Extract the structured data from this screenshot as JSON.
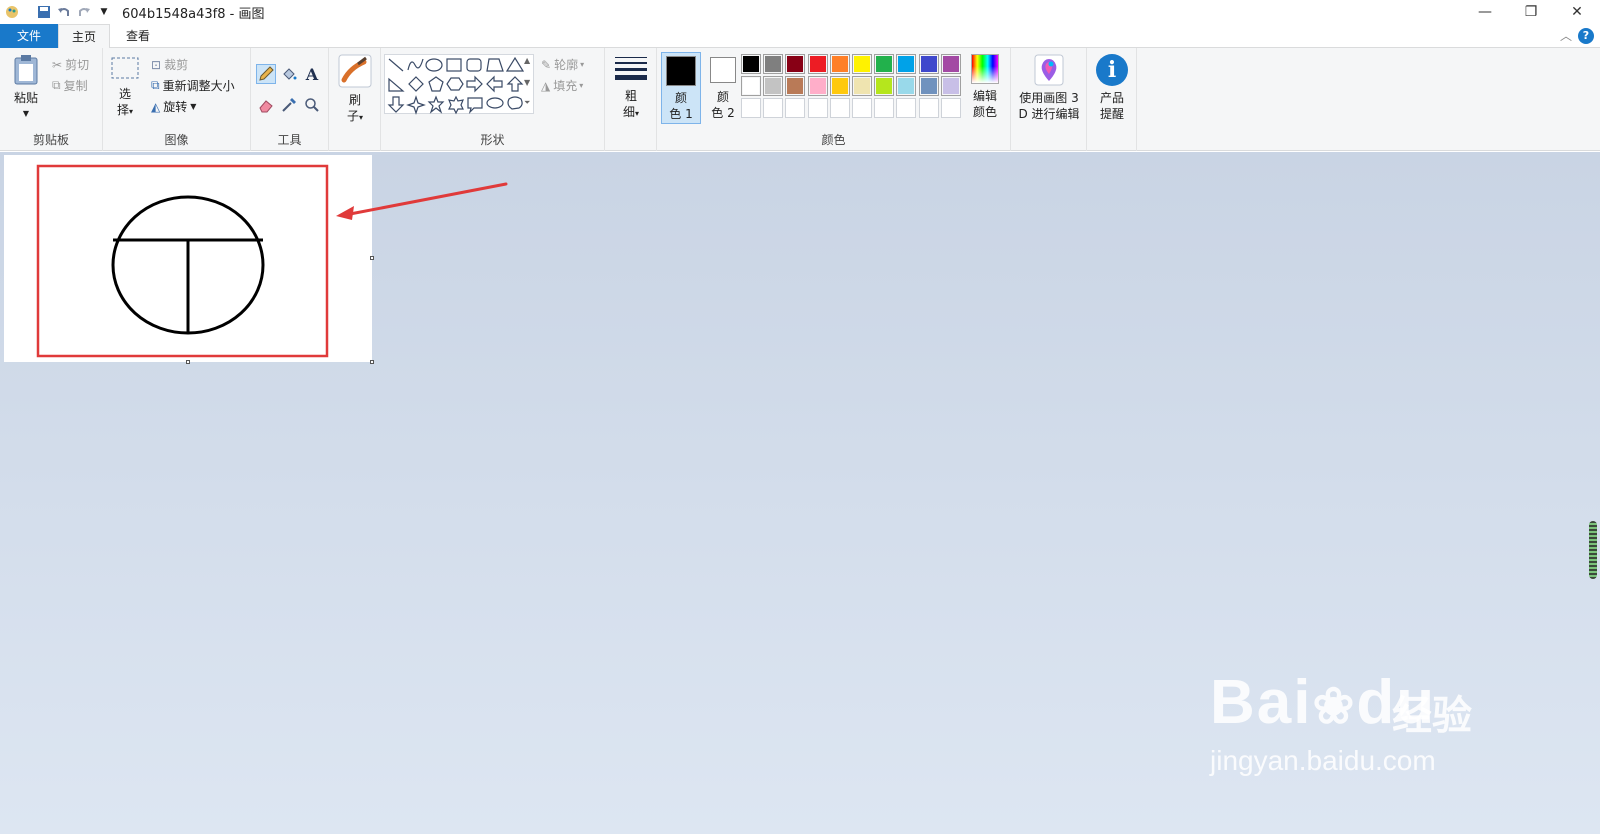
{
  "window": {
    "title": "604b1548a43f8 - 画图"
  },
  "tabs": {
    "file": "文件",
    "home": "主页",
    "view": "查看"
  },
  "clipboard": {
    "paste": "粘贴",
    "cut": "剪切",
    "copy": "复制",
    "group": "剪贴板"
  },
  "image": {
    "select_top": "选",
    "select_bottom": "择",
    "crop": "裁剪",
    "resize": "重新调整大小",
    "rotate": "旋转",
    "group": "图像"
  },
  "tools": {
    "group": "工具"
  },
  "brushes": {
    "top": "刷",
    "bottom": "子"
  },
  "shapes": {
    "outline": "轮廓",
    "fill": "填充",
    "group": "形状"
  },
  "size": {
    "top": "粗",
    "bottom": "细"
  },
  "colors": {
    "color1_top": "颜",
    "color1_bottom": "色 1",
    "color2_top": "颜",
    "color2_bottom": "色 2",
    "edit_top": "编辑",
    "edit_bottom": "颜色",
    "group": "颜色",
    "palette_row1": [
      "#000000",
      "#7f7f7f",
      "#880015",
      "#ed1c24",
      "#ff7f27",
      "#fff200",
      "#22b14c",
      "#00a2e8",
      "#3f48cc",
      "#a349a4"
    ],
    "palette_row2": [
      "#ffffff",
      "#c3c3c3",
      "#b97a57",
      "#ffaec9",
      "#ffc90e",
      "#efe4b0",
      "#b5e61d",
      "#99d9ea",
      "#7092be",
      "#c8bfe7"
    ],
    "primary": "#000000",
    "secondary": "#ffffff"
  },
  "paint3d": {
    "top": "使用画图 3",
    "bottom": "D 进行编辑"
  },
  "product": {
    "top": "产品",
    "bottom": "提醒"
  },
  "annotation": {
    "highlight_color": "#e03a3a"
  },
  "watermark": {
    "brand": "Bai",
    "brand_tail": "du",
    "suffix": "经验",
    "url": "jingyan.baidu.com"
  }
}
